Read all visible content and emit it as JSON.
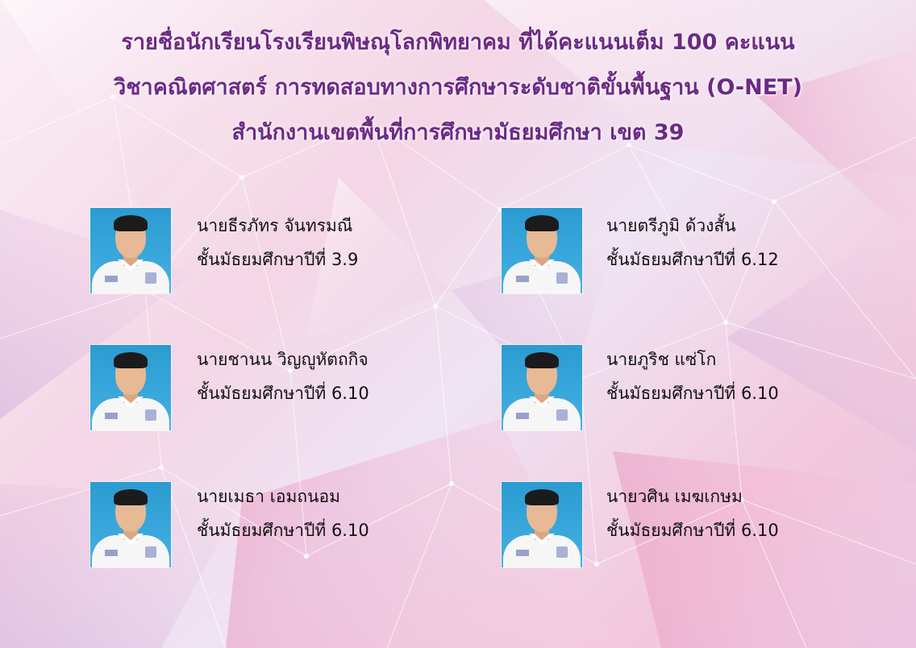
{
  "header": {
    "line1": "รายชื่อนักเรียนโรงเรียนพิษณุโลกพิทยาคม ที่ได้คะแนนเต็ม 100 คะแนน",
    "line2": "วิชาคณิตศาสตร์ การทดสอบทางการศึกษาระดับชาติขั้นพื้นฐาน (O-NET)",
    "line3": "สำนักงานเขตพื้นที่การศึกษามัธยมศึกษา เขต 39"
  },
  "students": [
    {
      "name": "นายธีรภัทร จันทรมณี",
      "grade": "ชั้นมัธยมศึกษาปีที่ 3.9"
    },
    {
      "name": "นายตรีภูมิ   ด้วงสั้น",
      "grade": "ชั้นมัธยมศึกษาปีที่ 6.12"
    },
    {
      "name": "นายชานน  วิญญูหัตถกิจ",
      "grade": "ชั้นมัธยมศึกษาปีที่ 6.10"
    },
    {
      "name": "นายภูริช  แซ่โก",
      "grade": "ชั้นมัธยมศึกษาปีที่ 6.10"
    },
    {
      "name": "นายเมธา   เอมถนอม",
      "grade": "ชั้นมัธยมศึกษาปีที่ 6.10"
    },
    {
      "name": "นายวศิน  เมฆเกษม",
      "grade": "ชั้นมัธยมศึกษาปีที่ 6.10"
    }
  ],
  "colors": {
    "title": "#6b2a86",
    "text": "#111111",
    "photo_bg": "#2b9bd1"
  }
}
